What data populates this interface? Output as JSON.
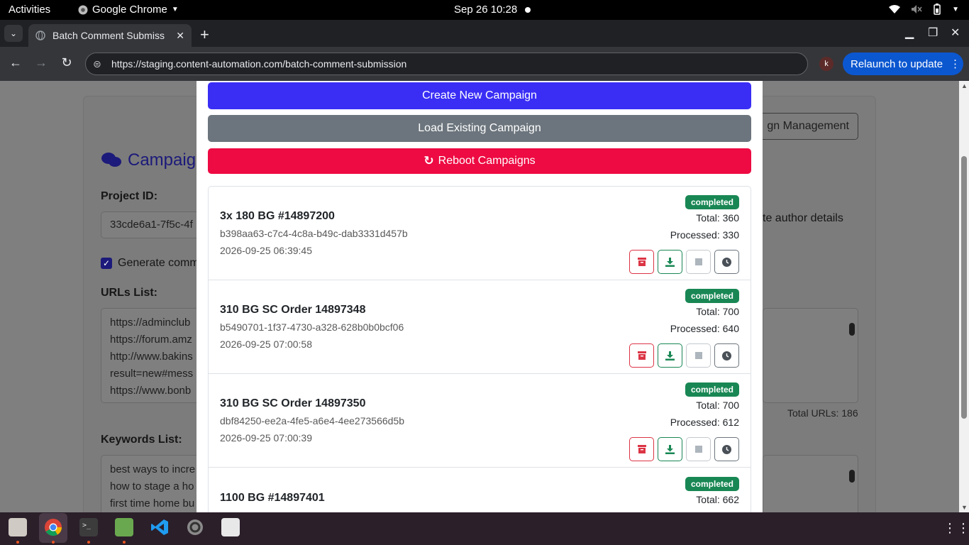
{
  "topbar": {
    "activities": "Activities",
    "app_name": "Google Chrome",
    "clock": "Sep 26  10:28"
  },
  "browser": {
    "tab_title": "Batch Comment Submiss",
    "url": "https://staging.content-automation.com/batch-comment-submission",
    "profile_initial": "k",
    "relaunch_label": "Relaunch to update"
  },
  "background_page": {
    "heading": "Campaig",
    "project_id_label": "Project ID:",
    "project_id_value": "33cde6a1-7f5c-4f",
    "generate_checkbox_label": "Generate comm",
    "urls_label": "URLs List:",
    "urls_lines": [
      "https://adminclub",
      "https://forum.amz",
      "http://www.bakins",
      "result=new#mess",
      "https://www.bonb"
    ],
    "total_urls": "Total URLs: 186",
    "keywords_label": "Keywords List:",
    "keywords_lines": [
      "best ways to incre",
      "how to stage a ho",
      "first time home bu"
    ],
    "campaign_management_fragment": "gn Management",
    "author_details_fragment": "te author details"
  },
  "modal": {
    "create_label": "Create New Campaign",
    "load_label": "Load Existing Campaign",
    "reboot_label": "Reboot Campaigns",
    "colors": {
      "create": "#3a2ef5",
      "load": "#6c757d",
      "reboot": "#ee0a42",
      "badge": "#198754"
    },
    "campaigns": [
      {
        "name": "3x 180 BG #14897200",
        "uuid": "b398aa63-c7c4-4c8a-b49c-dab3331d457b",
        "date": "2026-09-25 06:39:45",
        "status": "completed",
        "total": "Total: 360",
        "processed": "Processed: 330"
      },
      {
        "name": "310 BG SC Order 14897348",
        "uuid": "b5490701-1f37-4730-a328-628b0b0bcf06",
        "date": "2026-09-25 07:00:58",
        "status": "completed",
        "total": "Total: 700",
        "processed": "Processed: 640"
      },
      {
        "name": "310 BG SC Order 14897350",
        "uuid": "dbf84250-ee2a-4fe5-a6e4-4ee273566d5b",
        "date": "2026-09-25 07:00:39",
        "status": "completed",
        "total": "Total: 700",
        "processed": "Processed: 612"
      },
      {
        "name": "1100 BG #14897401",
        "uuid": "",
        "date": "",
        "status": "completed",
        "total": "Total: 662",
        "processed": ""
      }
    ]
  },
  "dock": {
    "apps": [
      "files-icon",
      "chrome-icon",
      "terminal-icon",
      "image-editor-icon",
      "vscode-icon",
      "settings-icon",
      "app-icon"
    ]
  }
}
